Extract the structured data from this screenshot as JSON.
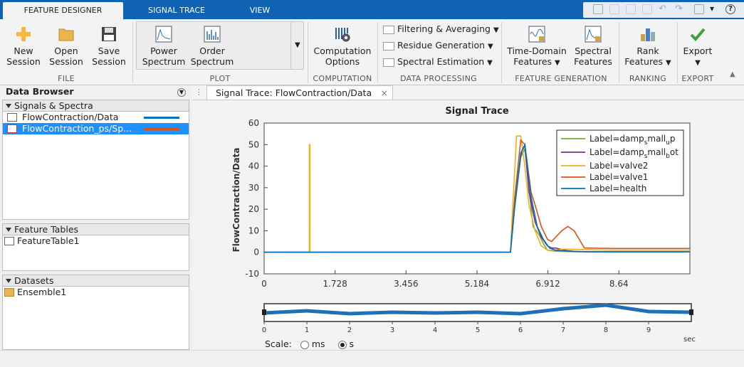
{
  "tabs": [
    {
      "label": "FEATURE DESIGNER",
      "active": true
    },
    {
      "label": "SIGNAL TRACE",
      "active": false
    },
    {
      "label": "VIEW",
      "active": false
    }
  ],
  "ribbon": {
    "file": {
      "group_label": "FILE",
      "new_session": [
        "New",
        "Session"
      ],
      "open_session": [
        "Open",
        "Session"
      ],
      "save_session": [
        "Save",
        "Session"
      ]
    },
    "plot": {
      "group_label": "PLOT",
      "power_spectrum": [
        "Power",
        "Spectrum"
      ],
      "order_spectrum": [
        "Order",
        "Spectrum"
      ]
    },
    "computation": {
      "group_label": "COMPUTATION",
      "computation_options": [
        "Computation",
        "Options"
      ]
    },
    "data_processing": {
      "group_label": "DATA PROCESSING",
      "filtering": "Filtering & Averaging",
      "residue": "Residue Generation",
      "spectral_estimation": "Spectral Estimation"
    },
    "feature_generation": {
      "group_label": "FEATURE GENERATION",
      "time_domain": [
        "Time-Domain",
        "Features"
      ],
      "spectral": [
        "Spectral",
        "Features"
      ]
    },
    "ranking": {
      "group_label": "RANKING",
      "rank_features": [
        "Rank",
        "Features"
      ]
    },
    "export": {
      "group_label": "EXPORT",
      "export": "Export"
    }
  },
  "data_browser": {
    "title": "Data Browser",
    "signals_header": "Signals & Spectra",
    "signals": [
      {
        "name": "FlowContraction/Data",
        "color": "#0072bd",
        "selected": false
      },
      {
        "name": "FlowContraction_ps/Sp...",
        "color": "#d95319",
        "selected": true
      }
    ],
    "feature_tables_header": "Feature Tables",
    "feature_tables": [
      "FeatureTable1"
    ],
    "datasets_header": "Datasets",
    "datasets": [
      "Ensemble1"
    ]
  },
  "document_tab": {
    "label": "Signal Trace: FlowContraction/Data"
  },
  "scale": {
    "label": "Scale:",
    "options": [
      "ms",
      "s"
    ],
    "selected": "s"
  },
  "panner": {
    "ticks": [
      "0",
      "1",
      "2",
      "3",
      "4",
      "5",
      "6",
      "7",
      "8",
      "9"
    ],
    "unit": "sec"
  },
  "chart_data": {
    "type": "line",
    "title": "Signal Trace",
    "xlabel": "",
    "ylabel": "FlowContraction/Data",
    "xlim": [
      0,
      10.37
    ],
    "ylim": [
      -10,
      60
    ],
    "xticks": [
      "0",
      "1.728",
      "3.456",
      "5.184",
      "6.912",
      "8.64"
    ],
    "yticks": [
      "60",
      "50",
      "40",
      "30",
      "20",
      "10",
      "0",
      "-10"
    ],
    "legend_placement": "top-right",
    "series": [
      {
        "name": "Label=damp_small_up",
        "label_main": "Label=damp",
        "label_sub": "s",
        "label_rest": "mall",
        "label_sub2": "u",
        "label_end": "p",
        "color": "#77ac30",
        "x": [
          0,
          1.0,
          2,
          3,
          4,
          5,
          6.0,
          6.1,
          6.25,
          6.35,
          6.45,
          6.55,
          6.7,
          6.8,
          6.9,
          7.1,
          7.5,
          8,
          9,
          10.37
        ],
        "y": [
          0,
          0,
          0,
          0,
          0,
          0,
          0,
          20,
          44,
          48,
          30,
          12,
          8,
          4,
          1,
          0.5,
          0.3,
          0.2,
          0.2,
          0.2
        ]
      },
      {
        "name": "Label=damp_small_bot",
        "label_main": "Label=damp",
        "label_sub": "s",
        "label_rest": "mall",
        "label_sub2": "b",
        "label_end": "ot",
        "color": "#7e2f8e",
        "x": [
          0,
          2,
          4,
          6.0,
          6.1,
          6.25,
          6.35,
          6.45,
          6.6,
          6.75,
          6.9,
          7.0,
          7.1,
          7.3,
          7.6,
          8,
          9,
          10.37
        ],
        "y": [
          0,
          0,
          0,
          0,
          22,
          45,
          50,
          28,
          14,
          7,
          3,
          2,
          2,
          1,
          0.3,
          0.2,
          0.2,
          0.2
        ]
      },
      {
        "name": "Label=valve2",
        "label_main": "Label=valve2",
        "color": "#edb120",
        "x": [
          0,
          1.1,
          1.101,
          1.115,
          1.116,
          2,
          4,
          6.0,
          6.05,
          6.15,
          6.25,
          6.35,
          6.45,
          6.6,
          6.75,
          6.9,
          7.1,
          7.3,
          7.8,
          8.5,
          10.37
        ],
        "y": [
          0,
          0,
          50,
          50,
          0,
          0,
          0,
          0,
          20,
          54,
          54,
          40,
          22,
          10,
          3,
          1,
          1,
          1.5,
          1.2,
          1,
          1
        ]
      },
      {
        "name": "Label=valve1",
        "label_main": "Label=valve1",
        "color": "#d95319",
        "x": [
          0,
          2,
          4,
          6.0,
          6.1,
          6.25,
          6.35,
          6.5,
          6.6,
          6.75,
          6.9,
          7.0,
          7.1,
          7.25,
          7.4,
          7.55,
          7.8,
          8.5,
          9.5,
          10.37
        ],
        "y": [
          0,
          0,
          0,
          0,
          25,
          52,
          50,
          28,
          22,
          12,
          6,
          5,
          7,
          10,
          12,
          10,
          2,
          1.8,
          1.8,
          1.8
        ]
      },
      {
        "name": "Label=health",
        "label_main": "Label=health",
        "color": "#0072bd",
        "x": [
          0,
          2,
          4,
          6.0,
          6.1,
          6.25,
          6.35,
          6.5,
          6.65,
          6.8,
          6.95,
          7.1,
          7.4,
          8,
          9,
          10.37
        ],
        "y": [
          0,
          0,
          0,
          0,
          21,
          46,
          50,
          26,
          12,
          6,
          2,
          1,
          0.5,
          0.2,
          0.2,
          0.2
        ]
      }
    ]
  }
}
